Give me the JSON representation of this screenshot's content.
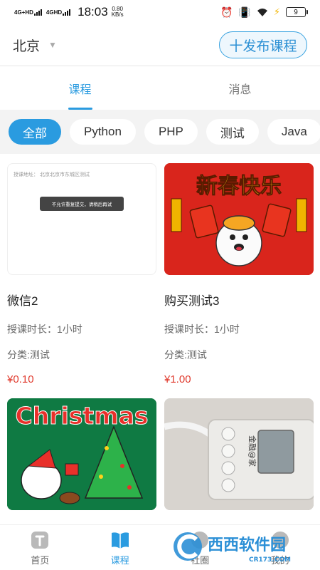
{
  "status_bar": {
    "network_1": "4G+HD",
    "network_2": "4GHD",
    "time": "18:03",
    "speed_value": "0.80",
    "speed_unit": "KB/s",
    "battery": "9"
  },
  "header": {
    "city": "北京",
    "publish_button": "十发布课程"
  },
  "tabs": [
    {
      "label": "课程"
    },
    {
      "label": "消息"
    }
  ],
  "categories": [
    {
      "label": "全部"
    },
    {
      "label": "Python"
    },
    {
      "label": "PHP"
    },
    {
      "label": "测试"
    },
    {
      "label": "Java"
    }
  ],
  "courses": [
    {
      "title": "微信2",
      "duration": "授课时长：1小时",
      "category": "分类:测试",
      "price": "¥0.10",
      "image_text": {
        "address": "授课地址：    北京北京市东城区测试",
        "toast": "不允许重复提交，请稍后再试"
      }
    },
    {
      "title": "购买测试3",
      "duration": "授课时长：1小时",
      "category": "分类:测试",
      "price": "¥1.00",
      "image_text": {
        "headline": "新春快乐"
      }
    },
    {
      "image_text": {
        "headline": "Christmas"
      }
    },
    {
      "image_text": {
        "device_label": "金融@家"
      }
    }
  ],
  "bottom_nav": [
    {
      "label": "首页"
    },
    {
      "label": "课程"
    },
    {
      "label": "社圈"
    },
    {
      "label": "我的"
    }
  ],
  "watermark": {
    "name": "西西软件园",
    "url": "CR173.COM"
  },
  "colors": {
    "accent": "#2a9be0",
    "price": "#e03a2d",
    "new_year_red": "#d9251c",
    "christmas_green": "#0f7a43"
  }
}
